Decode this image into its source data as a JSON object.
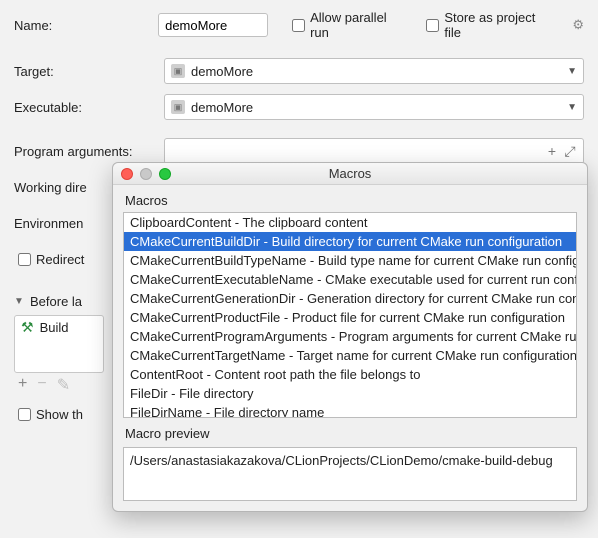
{
  "form": {
    "name_label": "Name:",
    "name_value": "demoMore",
    "allow_parallel": "Allow parallel run",
    "store_project": "Store as project file",
    "target_label": "Target:",
    "target_value": "demoMore",
    "exec_label": "Executable:",
    "exec_value": "demoMore",
    "args_label": "Program arguments:",
    "workdir_label": "Working dire",
    "env_label": "Environmen",
    "redirect_label": "Redirect",
    "before_label": "Before la",
    "build_task": "Build",
    "show_label": "Show th"
  },
  "dialog": {
    "title": "Macros",
    "section": "Macros",
    "items": [
      "ClipboardContent - The clipboard content",
      "CMakeCurrentBuildDir - Build directory for current CMake run configuration",
      "CMakeCurrentBuildTypeName - Build type name for current CMake run configu",
      "CMakeCurrentExecutableName - CMake executable used for current run config",
      "CMakeCurrentGenerationDir - Generation directory for current CMake run con",
      "CMakeCurrentProductFile - Product file for current CMake run configuration",
      "CMakeCurrentProgramArguments - Program arguments for current CMake run",
      "CMakeCurrentTargetName - Target name for current CMake run configuration",
      "ContentRoot - Content root path the file belongs to",
      "FileDir - File directory",
      "FileDirName - File directory name"
    ],
    "selected_index": 1,
    "preview_label": "Macro preview",
    "preview_value": "/Users/anastasiakazakova/CLionProjects/CLionDemo/cmake-build-debug"
  }
}
